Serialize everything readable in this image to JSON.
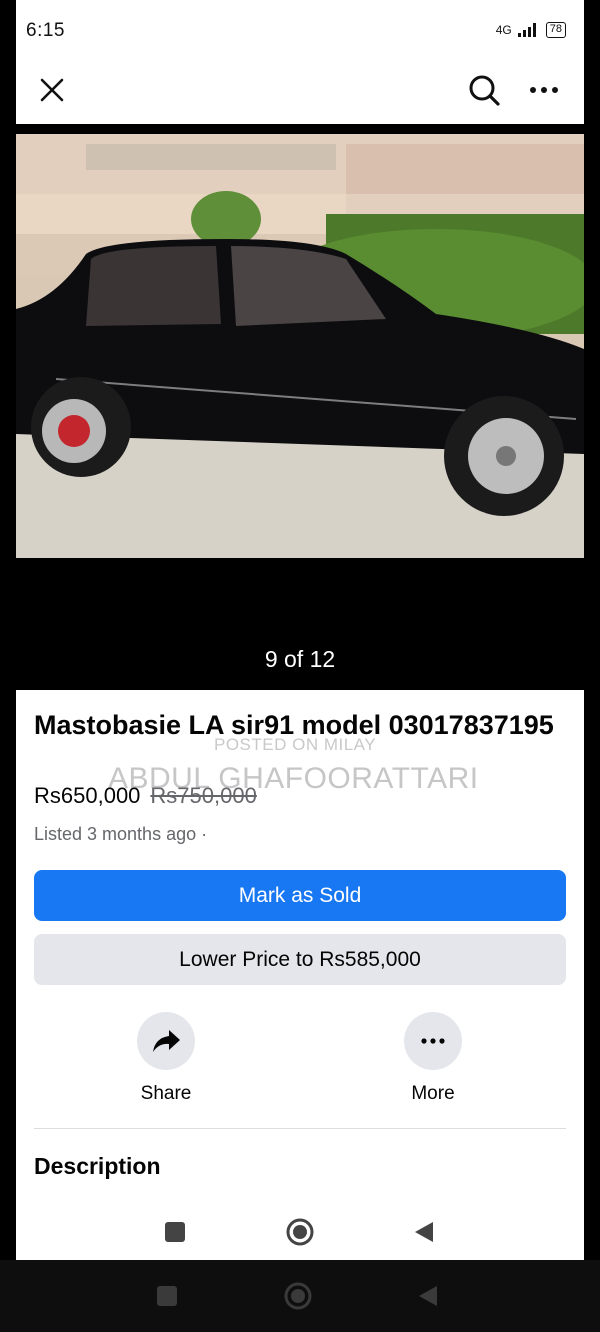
{
  "status": {
    "time": "6:15",
    "network": "4G",
    "battery": "78"
  },
  "viewer": {
    "counter": "9 of 12"
  },
  "listing": {
    "title": "Mastobasie LA sir91 model 03017837195",
    "price": "Rs650,000",
    "original_price": "Rs750,000",
    "listed": "Listed 3 months ago ·"
  },
  "watermark": {
    "line1": "POSTED ON MILAY",
    "line2": "ABDUL GHAFOORATTARI"
  },
  "buttons": {
    "mark_sold": "Mark as Sold",
    "lower_price": "Lower Price to Rs585,000"
  },
  "actions": {
    "share": "Share",
    "more": "More"
  },
  "sections": {
    "description": "Description"
  },
  "icons": {
    "close": "close-icon",
    "search": "search-icon",
    "more": "more-horizontal-icon",
    "share": "share-arrow-icon",
    "recents": "square-nav-icon",
    "home": "circle-home-icon",
    "back": "triangle-back-icon"
  },
  "colors": {
    "primary": "#1877f2",
    "secondary_bg": "#e4e6eb",
    "text": "#050505",
    "muted": "#65676b"
  }
}
